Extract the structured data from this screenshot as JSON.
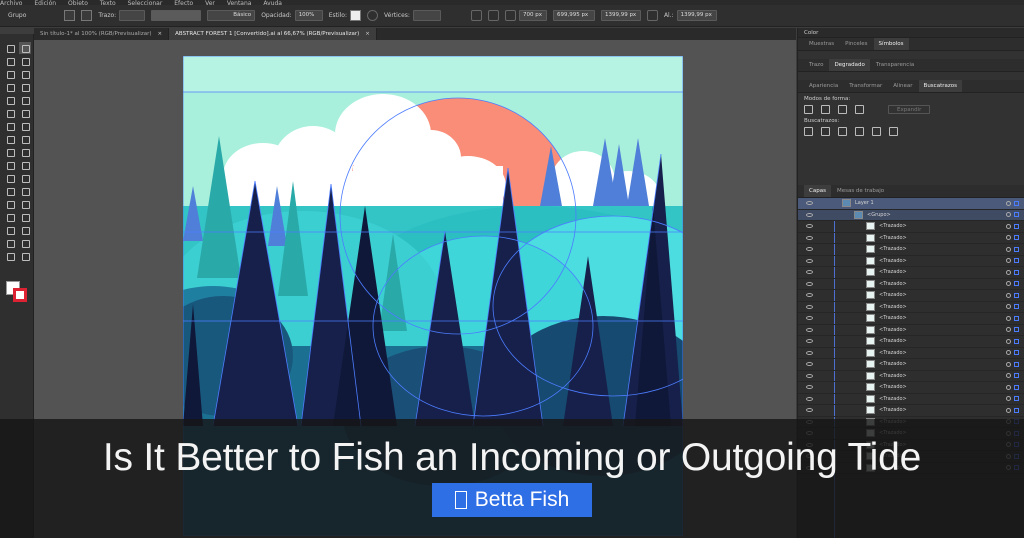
{
  "menubar": {
    "items": [
      "Archivo",
      "Edición",
      "Objeto",
      "Texto",
      "Seleccionar",
      "Efecto",
      "Ver",
      "Ventana",
      "Ayuda"
    ]
  },
  "controlbar": {
    "selection_type": "Grupo",
    "stroke_label": "Trazo:",
    "brush_style": "Básico",
    "opacity_label": "Opacidad:",
    "opacity_value": "100%",
    "style_label": "Estilo:",
    "vertices_label": "Vértices:",
    "width_value": "700 px",
    "x_value": "699,995 px",
    "w_value": "1399,99 px",
    "h_label": "Al.:",
    "h_value": "1399,99 px"
  },
  "tabs": [
    {
      "label": "Sin título-1* al 100% (RGB/Previsualizar)",
      "active": false
    },
    {
      "label": "ABSTRACT FOREST 1 [Convertido].ai al 66,67% (RGB/Previsualizar)",
      "active": true
    }
  ],
  "tab_close_glyph": "×",
  "panels": {
    "color_header": "Color",
    "group1_tabs": [
      "Muestras",
      "Pinceles",
      "Símbolos"
    ],
    "group2_tabs": [
      "Trazo",
      "Degradado",
      "Transparencia"
    ],
    "group3_tabs": [
      "Apariencia",
      "Transformar",
      "Alinear",
      "Buscatrazos"
    ],
    "shape_modes_label": "Modos de forma:",
    "expand_button": "Expandir",
    "pathfinders_label": "Buscatrazos:",
    "layers_tabs": [
      "Capas",
      "Mesas de trabajo"
    ],
    "layer_top": "Layer 1",
    "group_row": "<Grupo>",
    "path_label": "<Trazado>",
    "path_rows": 22
  },
  "caption": {
    "headline": "Is It Better to Fish an Incoming or Outgoing Tide",
    "category": "Betta Fish"
  },
  "icons": [
    "folder-icon",
    "eye-icon",
    "target-circle-icon",
    "close-icon",
    "panel-menu-icon"
  ],
  "colors": {
    "sky": "#a8f0dc",
    "sun": "#f98d78",
    "cloud": "#ffffff",
    "hill_light": "#3fd6da",
    "hill_mid": "#2bbfc2",
    "tree_dark": "#16204a",
    "tree_navy": "#0f1838",
    "tree_teal": "#2aa9a9",
    "tree_blue": "#4f7fd8",
    "selection": "#4c7cff",
    "category_bg": "#2f6fe6"
  }
}
